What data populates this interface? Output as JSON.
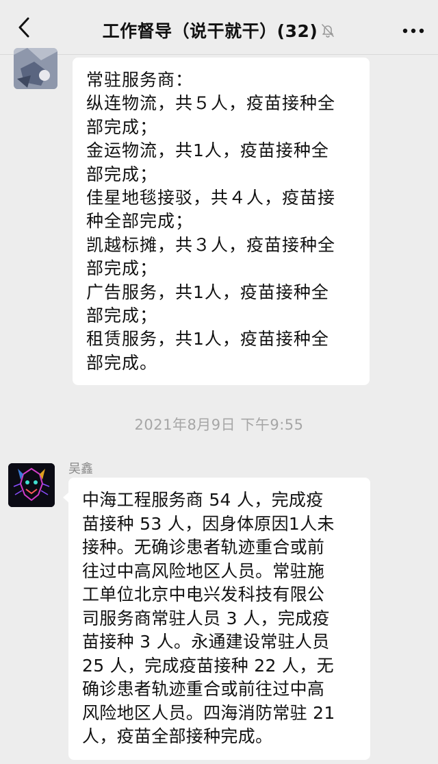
{
  "header": {
    "title": "工作督导（说干就干）(32)",
    "back_icon": "chevron-left-icon",
    "mute_icon": "bell-off-icon",
    "more_icon": "more-dots-icon"
  },
  "messages": [
    {
      "sender": "",
      "lines": [
        "常驻服务商：",
        "纵连物流，共５人，疫苗接种全",
        "部完成；",
        "金运物流，共1人，疫苗接种全",
        "部完成；",
        "佳星地毯接驳，共４人，疫苗接",
        "种全部完成；",
        "凯越标摊，共３人，疫苗接种全",
        "部完成；",
        "广告服务，共1人，疫苗接种全",
        "部完成；",
        "租赁服务，共1人，疫苗接种全",
        "部完成。"
      ]
    },
    {
      "sender": "吴鑫",
      "lines": [
        "中海工程服务商 54 人，完成疫",
        "苗接种 53 人，因身体原因1人未",
        "接种。无确诊患者轨迹重合或前",
        "往过中高风险地区人员。常驻施",
        "工单位北京中电兴发科技有限公",
        "司服务商常驻人员 3 人，完成疫",
        "苗接种 3 人。永通建设常驻人员",
        "25 人，完成疫苗接种 22 人，无",
        "确诊患者轨迹重合或前往过中高",
        "风险地区人员。四海消防常驻 21",
        "人，疫苗全部接种完成。"
      ]
    }
  ],
  "timestamp": "2021年8月9日 下午9:55",
  "colors": {
    "background": "#ededed",
    "bubble": "#ffffff",
    "timestamp": "#a6a6a6",
    "sender_name": "#8a8a8a"
  }
}
